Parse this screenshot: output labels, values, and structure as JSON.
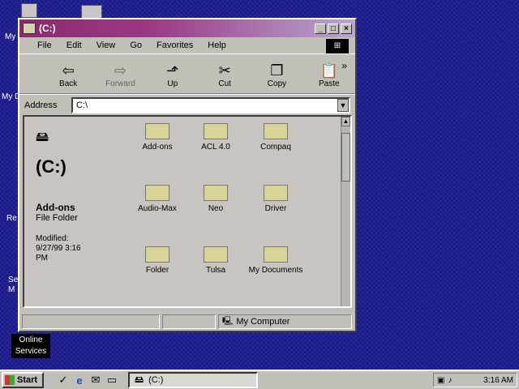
{
  "window": {
    "title": "(C:)",
    "menu": [
      "File",
      "Edit",
      "View",
      "Go",
      "Favorites",
      "Help"
    ],
    "toolbar": [
      {
        "label": "Back",
        "icon": "back-arrow-icon",
        "glyph": "⇦"
      },
      {
        "label": "Forward",
        "icon": "forward-arrow-icon",
        "glyph": "⇨"
      },
      {
        "label": "Up",
        "icon": "up-folder-icon",
        "glyph": "⬏"
      },
      {
        "label": "Cut",
        "icon": "scissors-icon",
        "glyph": "✂"
      },
      {
        "label": "Copy",
        "icon": "copy-icon",
        "glyph": "❐"
      },
      {
        "label": "Paste",
        "icon": "paste-icon",
        "glyph": "📋"
      }
    ],
    "address_label": "Address",
    "address_value": "C:\\",
    "sidebar": {
      "drive_label": "(C:)",
      "item_name": "Add-ons",
      "item_type": "File Folder",
      "modified_label": "Modified:",
      "modified_date": "9/27/99 3:16",
      "modified_time": "PM"
    },
    "folders": [
      "Add-ons",
      "ACL 4.0",
      "Compaq",
      "Audio-Max",
      "Neo",
      "Driver",
      "Folder",
      "Tulsa",
      "My Documents"
    ],
    "status_text": "My Computer"
  },
  "desktop": {
    "labels": [
      "My",
      "My D",
      "Re",
      "Se M",
      "Online Services"
    ]
  },
  "taskbar": {
    "start_label": "Start",
    "task_label": "(C:)",
    "time": "3:16 AM"
  },
  "colors": {
    "desktop": "#1a1a8a",
    "titlebar_start": "#8a2a6a",
    "window_face": "#c0c0b8"
  }
}
